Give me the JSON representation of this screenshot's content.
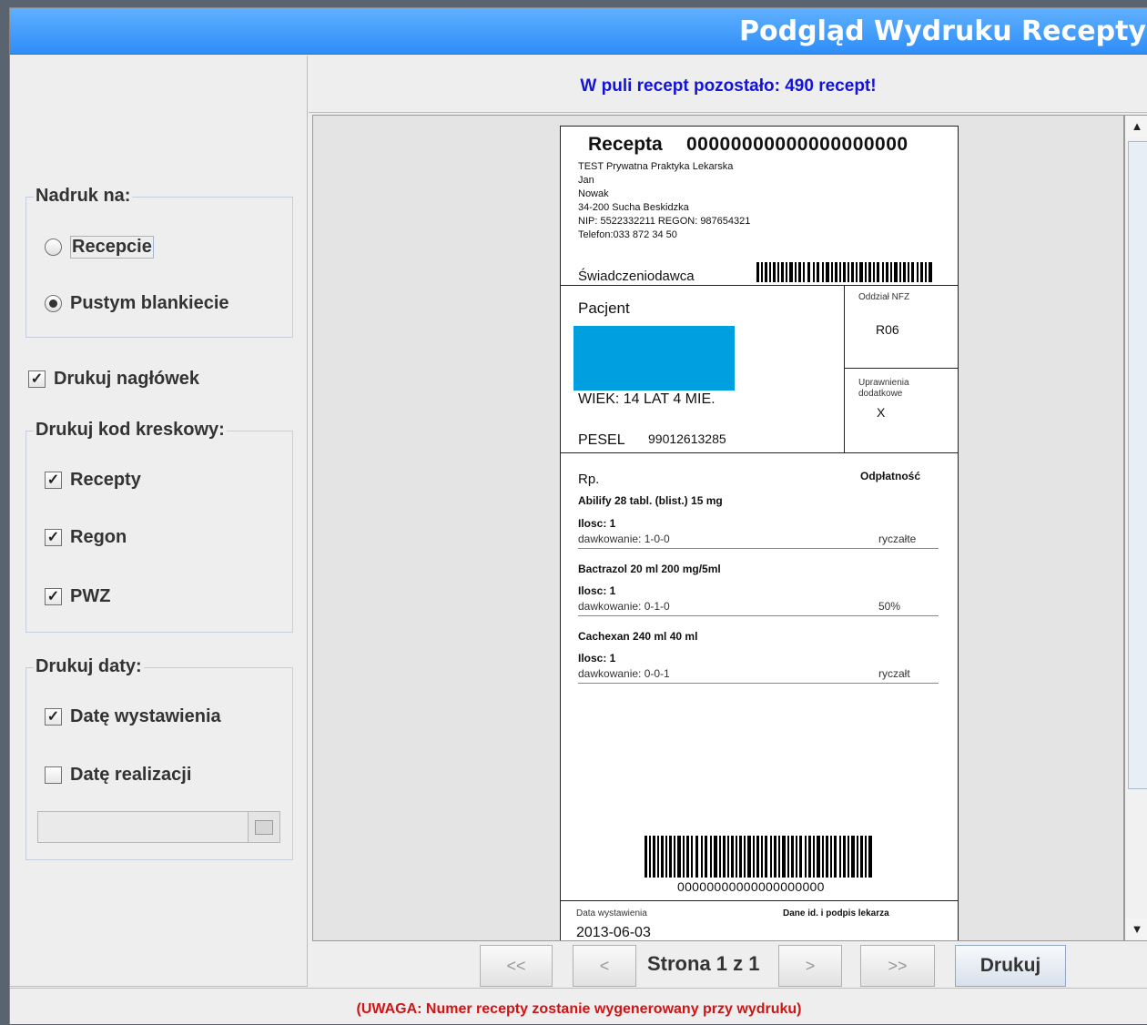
{
  "window": {
    "title": "Podgląd Wydruku Recepty"
  },
  "info": {
    "pool_text": "W puli recept pozostało: 490 recept!"
  },
  "options": {
    "nadruk": {
      "title": "Nadruk na:",
      "recepcie": "Recepcie",
      "pustym": "Pustym blankiecie",
      "selected": "Pustym blankiecie"
    },
    "drukuj_naglowek": {
      "label": "Drukuj nagłówek",
      "checked": true
    },
    "kod_kreskowy": {
      "title": "Drukuj kod kreskowy:",
      "recepty": "Recepty",
      "regon": "Regon",
      "pwz": "PWZ"
    },
    "daty": {
      "title": "Drukuj daty:",
      "wystawienia": "Datę wystawienia",
      "realizacji": "Datę realizacji"
    },
    "check_mark": "✓"
  },
  "prescription": {
    "title": "Recepta",
    "number": "00000000000000000000",
    "provider_lines": [
      "TEST Prywatna Praktyka Lekarska",
      "Jan",
      "Nowak",
      "34-200 Sucha Beskidzka",
      "NIP: 5522332211 REGON: 987654321",
      "Telefon:033 872 34 50"
    ],
    "provider_label": "Świadczeniodawca",
    "patient_label": "Pacjent",
    "nfz_label": "Oddział NFZ",
    "nfz_value": "R06",
    "uprawnienia_label_1": "Uprawnienia",
    "uprawnienia_label_2": "dodatkowe",
    "uprawnienia_value": "X",
    "age": "WIEK: 14 LAT 4 MIE.",
    "pesel_label": "PESEL",
    "pesel": "99012613285",
    "rp_label": "Rp.",
    "odplatnosc_label": "Odpłatność",
    "drugs": [
      {
        "name": "Abilify   28 tabl. (blist.)  15 mg",
        "qty": "Ilosc: 1",
        "dosage": "dawkowanie: 1-0-0",
        "payment": "ryczałte"
      },
      {
        "name": "Bactrazol   20 ml  200 mg/5ml",
        "qty": "Ilosc: 1",
        "dosage": "dawkowanie: 0-1-0",
        "payment": "50%"
      },
      {
        "name": "Cachexan   240 ml  40 ml",
        "qty": "Ilosc: 1",
        "dosage": "dawkowanie: 0-0-1",
        "payment": "ryczałt"
      }
    ],
    "barcode_number": "00000000000000000000",
    "issue_date_label": "Data wystawienia",
    "signature_label": "Dane id. i podpis lekarza",
    "issue_date": "2013-06-03"
  },
  "nav": {
    "first": "<<",
    "prev": "<",
    "next": ">",
    "last": ">>",
    "page_label": "Strona 1 z 1",
    "print": "Drukuj"
  },
  "status": {
    "warning": "(UWAGA: Numer recepty zostanie wygenerowany przy wydruku)"
  },
  "colors": {
    "title_bar": "#2f8df7",
    "patient_block": "#00a0e0",
    "info_text": "#1414d6",
    "warning_text": "#d01414"
  }
}
